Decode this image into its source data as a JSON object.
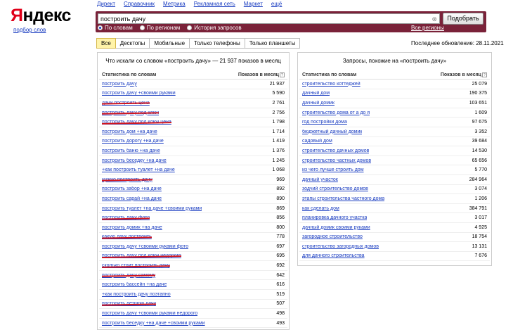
{
  "logo": {
    "first": "Я",
    "rest": "ндекс"
  },
  "subtitle": "подбор слов",
  "topnav": [
    "Директ",
    "Справочник",
    "Метрика",
    "Рекламная сеть",
    "Маркет",
    "ещё"
  ],
  "search": {
    "value": "построить дачу",
    "button_label": "Подобрать",
    "options": [
      "По словам",
      "По регионам",
      "История запросов"
    ],
    "selected_option": "По словам",
    "all_regions": "Все регионы"
  },
  "tabs": [
    "Все",
    "Десктопы",
    "Мобильные",
    "Только телефоны",
    "Только планшеты"
  ],
  "active_tab": "Все",
  "last_update": "Последнее обновление: 28.11.2021",
  "left": {
    "title": "Что искали со словом «построить дачу» — 21 937 показов в месяц",
    "col_query": "Статистика по словам",
    "col_shows": "Показов в месяц",
    "rows": [
      {
        "q": "построить дачу",
        "v": "21 937",
        "struck": false
      },
      {
        "q": "построить дачу +своими руками",
        "v": "5 590",
        "struck": false
      },
      {
        "q": "дачи построить цена",
        "v": "2 761",
        "struck": true
      },
      {
        "q": "построить дачу под ключ",
        "v": "2 756",
        "struck": true
      },
      {
        "q": "построить дачу под ключ цена",
        "v": "1 798",
        "struck": true
      },
      {
        "q": "построить дом +на даче",
        "v": "1 714",
        "struck": false
      },
      {
        "q": "построить дорогу +на даче",
        "v": "1 419",
        "struck": false
      },
      {
        "q": "построить баню +на даче",
        "v": "1 376",
        "struck": false
      },
      {
        "q": "построить беседку +на даче",
        "v": "1 245",
        "struck": false
      },
      {
        "q": "+как построить туалет +на даче",
        "v": "1 068",
        "struck": false
      },
      {
        "q": "нужно построить дачу",
        "v": "969",
        "struck": true
      },
      {
        "q": "построить забор +на даче",
        "v": "892",
        "struck": false
      },
      {
        "q": "построить сарай +на даче",
        "v": "890",
        "struck": false
      },
      {
        "q": "построить туалет +на даче +своими руками",
        "v": "869",
        "struck": false
      },
      {
        "q": "построить дачу фото",
        "v": "856",
        "struck": true
      },
      {
        "q": "построить домик +на даче",
        "v": "800",
        "struck": false
      },
      {
        "q": "какую дачу построить",
        "v": "778",
        "struck": true
      },
      {
        "q": "построить дачу +своими руками фото",
        "v": "697",
        "struck": false
      },
      {
        "q": "построить дачу под ключ недорого",
        "v": "695",
        "struck": true
      },
      {
        "q": "сколько стоит построить дачу",
        "v": "692",
        "struck": true
      },
      {
        "q": "построить дачу самому",
        "v": "642",
        "struck": true
      },
      {
        "q": "построить бассейн +на даче",
        "v": "616",
        "struck": false
      },
      {
        "q": "+как построить дачу поэтапно",
        "v": "519",
        "struck": false
      },
      {
        "q": "построить летнюю дачу",
        "v": "507",
        "struck": true
      },
      {
        "q": "построить дачу +своими руками недорого",
        "v": "498",
        "struck": false
      },
      {
        "q": "построить беседку +на даче +своими руками",
        "v": "493",
        "struck": false
      }
    ]
  },
  "right": {
    "title": "Запросы, похожие на «построить дачу»",
    "col_query": "Статистика по словам",
    "col_shows": "Показов в месяц",
    "rows": [
      {
        "q": "строительство коттеджей",
        "v": "25 079"
      },
      {
        "q": "дачный дом",
        "v": "190 375"
      },
      {
        "q": "дачный домик",
        "v": "103 651"
      },
      {
        "q": "строительство дома от а до я",
        "v": "1 609"
      },
      {
        "q": "год постройки дома",
        "v": "97 675"
      },
      {
        "q": "бюджетный дачный домик",
        "v": "3 352"
      },
      {
        "q": "садовый дом",
        "v": "39 684"
      },
      {
        "q": "строительство дачных домов",
        "v": "14 530"
      },
      {
        "q": "строительство частных домов",
        "v": "65 656"
      },
      {
        "q": "из чего лучше строить дом",
        "v": "5 770"
      },
      {
        "q": "дачный участок",
        "v": "284 964"
      },
      {
        "q": "зодчий строительство домов",
        "v": "3 074"
      },
      {
        "q": "этапы строительства частного дома",
        "v": "1 206"
      },
      {
        "q": "как сделать дом",
        "v": "384 791"
      },
      {
        "q": "планировка дачного участка",
        "v": "3 017"
      },
      {
        "q": "дачный домик своими руками",
        "v": "4 925"
      },
      {
        "q": "загородное строительство",
        "v": "18 754"
      },
      {
        "q": "строительство загородных домов",
        "v": "13 131"
      },
      {
        "q": "для дачного строительства",
        "v": "7 676"
      }
    ]
  }
}
